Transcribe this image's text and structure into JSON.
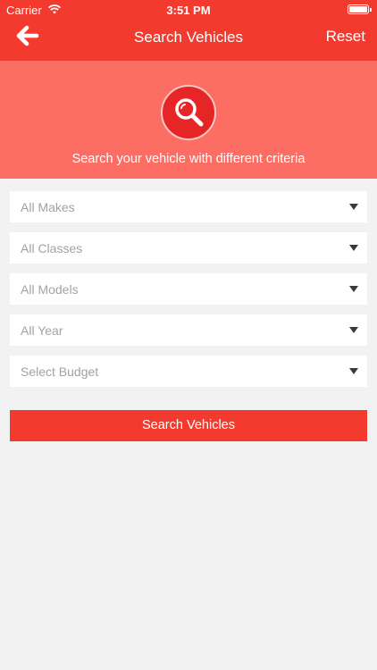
{
  "status_bar": {
    "carrier": "Carrier",
    "time": "3:51 PM"
  },
  "nav": {
    "title": "Search Vehicles",
    "back_icon": "arrow-left-icon",
    "reset_label": "Reset"
  },
  "hero": {
    "icon": "magnifier-icon",
    "text": "Search your vehicle with different criteria"
  },
  "filters": [
    {
      "label": "All Makes"
    },
    {
      "label": "All Classes"
    },
    {
      "label": "All Models"
    },
    {
      "label": "All Year"
    },
    {
      "label": "Select Budget"
    }
  ],
  "search_button": {
    "label": "Search Vehicles"
  },
  "colors": {
    "primary": "#f23a2e",
    "hero_bg": "#fc6e64",
    "icon_circle": "#e52526",
    "page_bg": "#f2f2f2",
    "placeholder": "#a2a2a2"
  }
}
